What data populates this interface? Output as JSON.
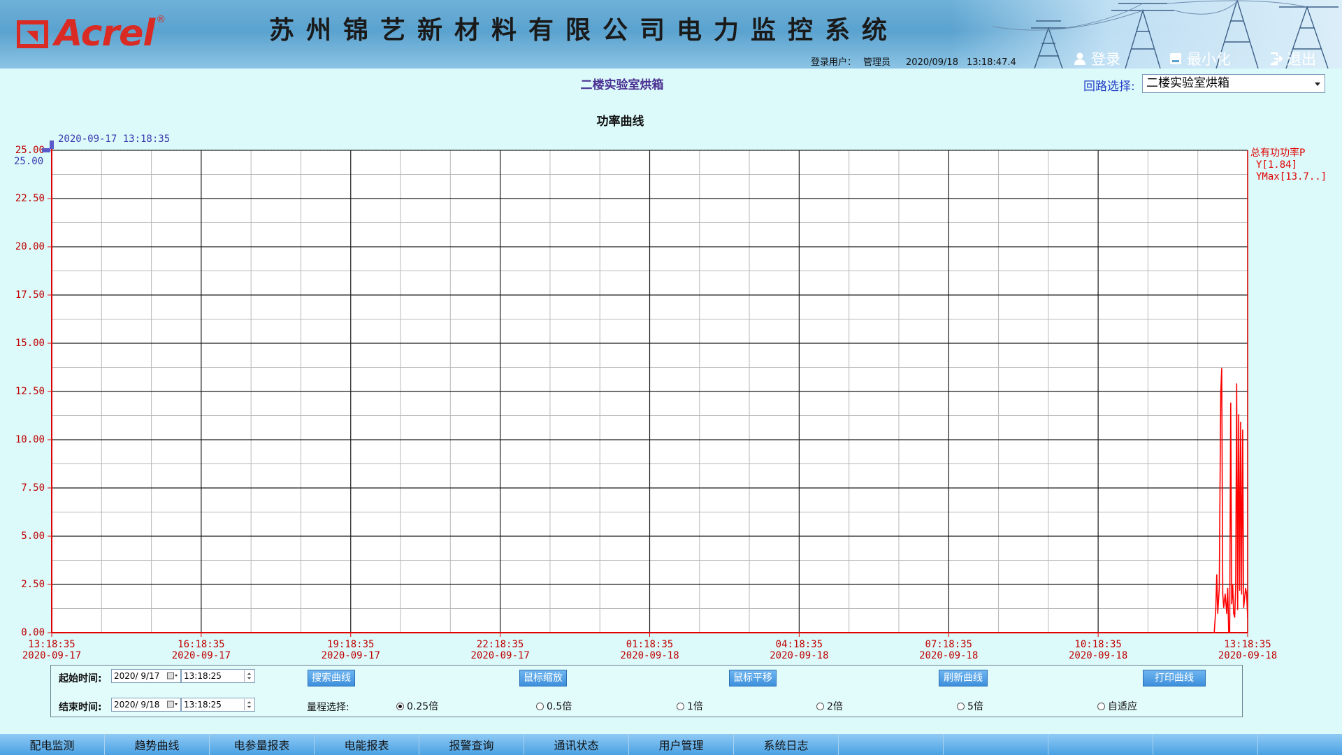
{
  "header": {
    "logo_text": "Acrel",
    "logo_reg": "®",
    "title": "苏州锦艺新材料有限公司电力监控系统",
    "user_label": "登录用户：",
    "user_name": "管理员",
    "date": "2020/09/18",
    "time": "13:18:47.4",
    "login_label": "登录",
    "minimize_label": "最小化",
    "logout_label": "退出"
  },
  "loop": {
    "title": "二楼实验室烘箱",
    "select_label": "回路选择:",
    "selected": "二楼实验室烘箱"
  },
  "chart_data": {
    "type": "line",
    "title": "功率曲线",
    "cursor_label": "2020-09-17 13:18:35",
    "cursor_value_label": "25.00",
    "series": [
      {
        "name": "总有功功率P",
        "color": "#ff0000",
        "y_label": "Y[1.84]",
        "ymax_label": "YMax[13.7..]",
        "points": [
          [
            23.3,
            0.0
          ],
          [
            23.33,
            0.0
          ],
          [
            23.36,
            1.2
          ],
          [
            23.38,
            3.0
          ],
          [
            23.4,
            1.0
          ],
          [
            23.43,
            2.3
          ],
          [
            23.46,
            12.4
          ],
          [
            23.48,
            13.7
          ],
          [
            23.5,
            2.0
          ],
          [
            23.52,
            1.3
          ],
          [
            23.55,
            2.0
          ],
          [
            23.58,
            1.0
          ],
          [
            23.6,
            2.3
          ],
          [
            23.62,
            0.0
          ],
          [
            23.64,
            0.0
          ],
          [
            23.66,
            11.9
          ],
          [
            23.68,
            1.5
          ],
          [
            23.7,
            2.5
          ],
          [
            23.72,
            1.0
          ],
          [
            23.74,
            0.8
          ],
          [
            23.76,
            2.4
          ],
          [
            23.78,
            12.9
          ],
          [
            23.8,
            1.2
          ],
          [
            23.82,
            11.3
          ],
          [
            23.84,
            2.2
          ],
          [
            23.86,
            10.9
          ],
          [
            23.88,
            2.0
          ],
          [
            23.9,
            10.5
          ],
          [
            23.92,
            1.3
          ],
          [
            23.94,
            1.8
          ],
          [
            23.96,
            2.3
          ],
          [
            23.98,
            2.0
          ],
          [
            24.0,
            0.8
          ]
        ]
      }
    ],
    "y_ticks": [
      "25.00",
      "22.50",
      "20.00",
      "17.50",
      "15.00",
      "12.50",
      "10.00",
      "7.50",
      "5.00",
      "2.50",
      "0.00"
    ],
    "ylim": [
      0,
      25
    ],
    "x_ticks": [
      {
        "time": "13:18:35",
        "date": "2020-09-17"
      },
      {
        "time": "16:18:35",
        "date": "2020-09-17"
      },
      {
        "time": "19:18:35",
        "date": "2020-09-17"
      },
      {
        "time": "22:18:35",
        "date": "2020-09-17"
      },
      {
        "time": "01:18:35",
        "date": "2020-09-18"
      },
      {
        "time": "04:18:35",
        "date": "2020-09-18"
      },
      {
        "time": "07:18:35",
        "date": "2020-09-18"
      },
      {
        "time": "10:18:35",
        "date": "2020-09-18"
      },
      {
        "time": "13:18:35",
        "date": "2020-09-18"
      }
    ],
    "xlim_hours": [
      0,
      24
    ],
    "grid": true
  },
  "controls": {
    "start_label": "起始时间:",
    "start_date": "2020/ 9/17",
    "start_time": "13:18:25",
    "end_label": "结束时间:",
    "end_date": "2020/ 9/18",
    "end_time": "13:18:25",
    "buttons": [
      "搜索曲线",
      "鼠标缩放",
      "鼠标平移",
      "刷新曲线",
      "打印曲线"
    ],
    "range_label": "量程选择:",
    "range_options": [
      "0.25倍",
      "0.5倍",
      "1倍",
      "2倍",
      "5倍",
      "自适应"
    ],
    "range_selected": 0
  },
  "tabs": [
    "配电监测",
    "趋势曲线",
    "电参量报表",
    "电能报表",
    "报警查询",
    "通讯状态",
    "用户管理",
    "系统日志",
    "",
    "",
    "",
    "",
    ""
  ],
  "colors": {
    "logo_red": "#d92b24",
    "series_red": "#ff0000",
    "axis_label_blue": "#2640c8",
    "title_purple": "#4a2f92"
  }
}
